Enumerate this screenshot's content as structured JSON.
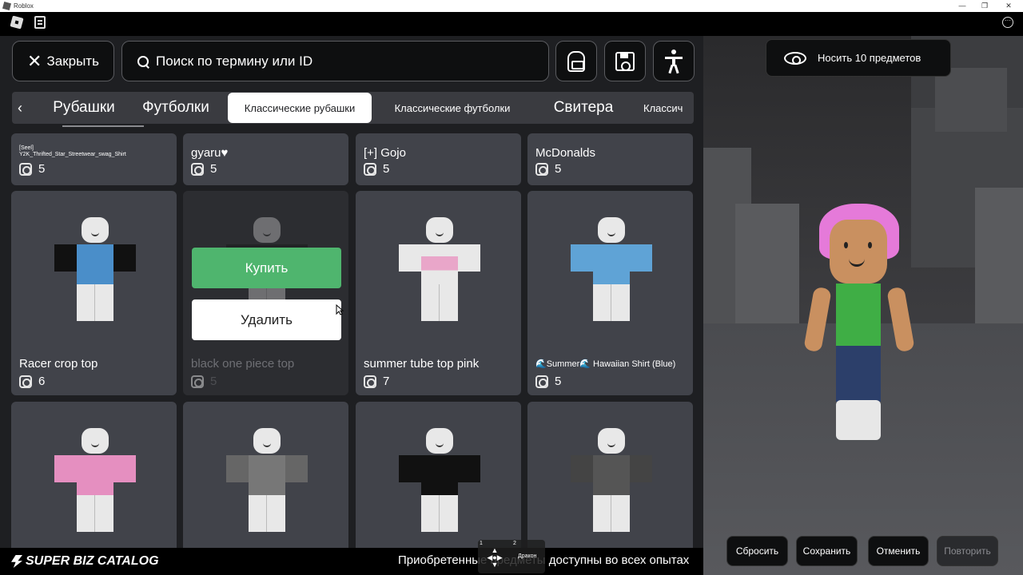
{
  "window": {
    "title": "Roblox",
    "controls": [
      "—",
      "❐",
      "✕"
    ]
  },
  "topbar": {
    "menu_icon": "roblox-logo-icon",
    "notes_icon": "notes-icon",
    "more_icon": "more-icon"
  },
  "header": {
    "close_label": "Закрыть",
    "search_placeholder": "Поиск по термину или ID",
    "backpack_icon": "backpack-icon",
    "save_icon": "floppy-disk-icon",
    "accessibility_icon": "person-icon"
  },
  "tabs": [
    {
      "label": "Рубашки",
      "size": "big"
    },
    {
      "label": "Футболки",
      "size": "big"
    },
    {
      "label": "Классические рубашки",
      "size": "small",
      "active": true
    },
    {
      "label": "Классические футболки",
      "size": "small"
    },
    {
      "label": "Свитера",
      "size": "big"
    },
    {
      "label": "Классич",
      "size": "small"
    }
  ],
  "items_row0": [
    {
      "name": "[Seel]\nY2K_Thrifted_Star_Streetwear_swag_Shirt",
      "price": "5",
      "tiny": true
    },
    {
      "name": "gyaru♥",
      "price": "5"
    },
    {
      "name": "[+] Gojo",
      "price": "5"
    },
    {
      "name": "McDonalds",
      "price": "5"
    }
  ],
  "items_row1": [
    {
      "name": "Racer crop top",
      "price": "6"
    },
    {
      "name": "black one piece top",
      "price": "5"
    },
    {
      "name": "summer tube top pink",
      "price": "7"
    },
    {
      "name": "🌊Summer🌊 Hawaiian Shirt (Blue)",
      "price": "5"
    }
  ],
  "overlay": {
    "buy_label": "Купить",
    "remove_label": "Удалить"
  },
  "footer": {
    "brand": "SUPER BIZ CATALOG",
    "notice": "Приобретенные предметы доступны во всех опытах",
    "nav_num1": "1",
    "nav_num2": "2",
    "nav_label": "Дракон"
  },
  "scene": {
    "wear_label": "Носить 10 предметов",
    "reset_label": "Сбросить",
    "save_label": "Сохранить",
    "undo_label": "Отменить",
    "redo_label": "Повторить"
  },
  "colors": {
    "accent_buy": "#4fb56e",
    "panel": "#1e1f22",
    "card": "#41434a"
  }
}
